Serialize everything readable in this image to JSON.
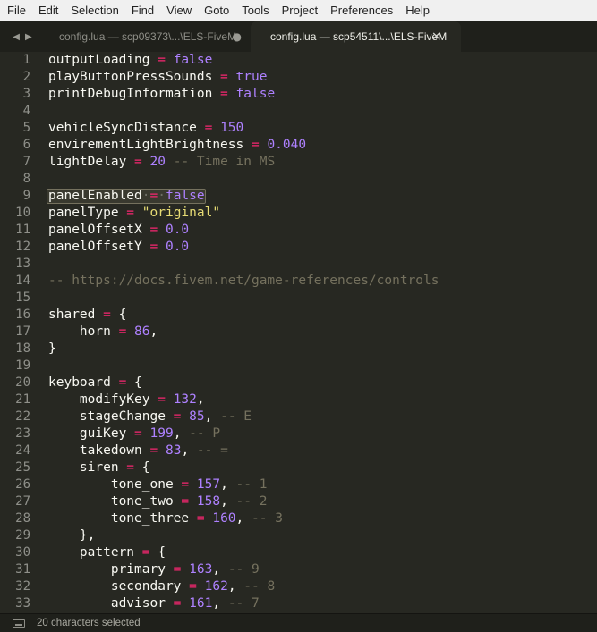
{
  "menu": [
    "File",
    "Edit",
    "Selection",
    "Find",
    "View",
    "Goto",
    "Tools",
    "Project",
    "Preferences",
    "Help"
  ],
  "tabs": [
    {
      "label": "config.lua — scp09373\\...\\ELS-FiveM",
      "indicator": "●",
      "active": false
    },
    {
      "label": "config.lua — scp54511\\...\\ELS-FiveM",
      "indicator": "✕",
      "active": true
    }
  ],
  "nav": {
    "back": "◀",
    "forward": "▶"
  },
  "editor": {
    "highlighted_line": 9,
    "lines": [
      {
        "n": "1",
        "tokens": [
          {
            "t": "outputLoading",
            "c": "plain"
          },
          {
            "t": " = ",
            "c": "op"
          },
          {
            "t": "false",
            "c": "const"
          }
        ]
      },
      {
        "n": "2",
        "tokens": [
          {
            "t": "playButtonPressSounds",
            "c": "plain"
          },
          {
            "t": " = ",
            "c": "op"
          },
          {
            "t": "true",
            "c": "const"
          }
        ]
      },
      {
        "n": "3",
        "tokens": [
          {
            "t": "printDebugInformation",
            "c": "plain"
          },
          {
            "t": " = ",
            "c": "op"
          },
          {
            "t": "false",
            "c": "const"
          }
        ]
      },
      {
        "n": "4",
        "tokens": []
      },
      {
        "n": "5",
        "tokens": [
          {
            "t": "vehicleSyncDistance",
            "c": "plain"
          },
          {
            "t": " = ",
            "c": "op"
          },
          {
            "t": "150",
            "c": "num"
          }
        ]
      },
      {
        "n": "6",
        "tokens": [
          {
            "t": "envirementLightBrightness",
            "c": "plain"
          },
          {
            "t": " = ",
            "c": "op"
          },
          {
            "t": "0.040",
            "c": "num"
          }
        ]
      },
      {
        "n": "7",
        "tokens": [
          {
            "t": "lightDelay",
            "c": "plain"
          },
          {
            "t": " = ",
            "c": "op"
          },
          {
            "t": "20",
            "c": "num"
          },
          {
            "t": " -- Time in MS",
            "c": "comment"
          }
        ]
      },
      {
        "n": "8",
        "tokens": []
      },
      {
        "n": "9",
        "tokens": [
          {
            "t": "panelEnabled",
            "c": "plain"
          },
          {
            "t": "·",
            "c": "ws"
          },
          {
            "t": "=",
            "c": "op"
          },
          {
            "t": "·",
            "c": "ws"
          },
          {
            "t": "false",
            "c": "const"
          }
        ]
      },
      {
        "n": "10",
        "tokens": [
          {
            "t": "panelType",
            "c": "plain"
          },
          {
            "t": " = ",
            "c": "op"
          },
          {
            "t": "\"original\"",
            "c": "str"
          }
        ]
      },
      {
        "n": "11",
        "tokens": [
          {
            "t": "panelOffsetX",
            "c": "plain"
          },
          {
            "t": " = ",
            "c": "op"
          },
          {
            "t": "0.0",
            "c": "num"
          }
        ]
      },
      {
        "n": "12",
        "tokens": [
          {
            "t": "panelOffsetY",
            "c": "plain"
          },
          {
            "t": " = ",
            "c": "op"
          },
          {
            "t": "0.0",
            "c": "num"
          }
        ]
      },
      {
        "n": "13",
        "tokens": []
      },
      {
        "n": "14",
        "tokens": [
          {
            "t": "-- https://docs.fivem.net/game-references/controls",
            "c": "comment"
          }
        ]
      },
      {
        "n": "15",
        "tokens": []
      },
      {
        "n": "16",
        "tokens": [
          {
            "t": "shared",
            "c": "plain"
          },
          {
            "t": " = ",
            "c": "op"
          },
          {
            "t": "{",
            "c": "plain"
          }
        ]
      },
      {
        "n": "17",
        "tokens": [
          {
            "t": "    horn",
            "c": "plain"
          },
          {
            "t": " = ",
            "c": "op"
          },
          {
            "t": "86",
            "c": "num"
          },
          {
            "t": ",",
            "c": "plain"
          }
        ]
      },
      {
        "n": "18",
        "tokens": [
          {
            "t": "}",
            "c": "plain"
          }
        ]
      },
      {
        "n": "19",
        "tokens": []
      },
      {
        "n": "20",
        "tokens": [
          {
            "t": "keyboard",
            "c": "plain"
          },
          {
            "t": " = ",
            "c": "op"
          },
          {
            "t": "{",
            "c": "plain"
          }
        ]
      },
      {
        "n": "21",
        "tokens": [
          {
            "t": "    modifyKey",
            "c": "plain"
          },
          {
            "t": " = ",
            "c": "op"
          },
          {
            "t": "132",
            "c": "num"
          },
          {
            "t": ",",
            "c": "plain"
          }
        ]
      },
      {
        "n": "22",
        "tokens": [
          {
            "t": "    stageChange",
            "c": "plain"
          },
          {
            "t": " = ",
            "c": "op"
          },
          {
            "t": "85",
            "c": "num"
          },
          {
            "t": ",",
            "c": "plain"
          },
          {
            "t": " -- E",
            "c": "comment"
          }
        ]
      },
      {
        "n": "23",
        "tokens": [
          {
            "t": "    guiKey",
            "c": "plain"
          },
          {
            "t": " = ",
            "c": "op"
          },
          {
            "t": "199",
            "c": "num"
          },
          {
            "t": ",",
            "c": "plain"
          },
          {
            "t": " -- P",
            "c": "comment"
          }
        ]
      },
      {
        "n": "24",
        "tokens": [
          {
            "t": "    takedown",
            "c": "plain"
          },
          {
            "t": " = ",
            "c": "op"
          },
          {
            "t": "83",
            "c": "num"
          },
          {
            "t": ",",
            "c": "plain"
          },
          {
            "t": " -- =",
            "c": "comment"
          }
        ]
      },
      {
        "n": "25",
        "tokens": [
          {
            "t": "    siren",
            "c": "plain"
          },
          {
            "t": " = ",
            "c": "op"
          },
          {
            "t": "{",
            "c": "plain"
          }
        ]
      },
      {
        "n": "26",
        "tokens": [
          {
            "t": "        tone_one",
            "c": "plain"
          },
          {
            "t": " = ",
            "c": "op"
          },
          {
            "t": "157",
            "c": "num"
          },
          {
            "t": ",",
            "c": "plain"
          },
          {
            "t": " -- 1",
            "c": "comment"
          }
        ]
      },
      {
        "n": "27",
        "tokens": [
          {
            "t": "        tone_two",
            "c": "plain"
          },
          {
            "t": " = ",
            "c": "op"
          },
          {
            "t": "158",
            "c": "num"
          },
          {
            "t": ",",
            "c": "plain"
          },
          {
            "t": " -- 2",
            "c": "comment"
          }
        ]
      },
      {
        "n": "28",
        "tokens": [
          {
            "t": "        tone_three",
            "c": "plain"
          },
          {
            "t": " = ",
            "c": "op"
          },
          {
            "t": "160",
            "c": "num"
          },
          {
            "t": ",",
            "c": "plain"
          },
          {
            "t": " -- 3",
            "c": "comment"
          }
        ]
      },
      {
        "n": "29",
        "tokens": [
          {
            "t": "    },",
            "c": "plain"
          }
        ]
      },
      {
        "n": "30",
        "tokens": [
          {
            "t": "    pattern",
            "c": "plain"
          },
          {
            "t": " = ",
            "c": "op"
          },
          {
            "t": "{",
            "c": "plain"
          }
        ]
      },
      {
        "n": "31",
        "tokens": [
          {
            "t": "        primary",
            "c": "plain"
          },
          {
            "t": " = ",
            "c": "op"
          },
          {
            "t": "163",
            "c": "num"
          },
          {
            "t": ",",
            "c": "plain"
          },
          {
            "t": " -- 9",
            "c": "comment"
          }
        ]
      },
      {
        "n": "32",
        "tokens": [
          {
            "t": "        secondary",
            "c": "plain"
          },
          {
            "t": " = ",
            "c": "op"
          },
          {
            "t": "162",
            "c": "num"
          },
          {
            "t": ",",
            "c": "plain"
          },
          {
            "t": " -- 8",
            "c": "comment"
          }
        ]
      },
      {
        "n": "33",
        "tokens": [
          {
            "t": "        advisor",
            "c": "plain"
          },
          {
            "t": " = ",
            "c": "op"
          },
          {
            "t": "161",
            "c": "num"
          },
          {
            "t": ",",
            "c": "plain"
          },
          {
            "t": " -- 7",
            "c": "comment"
          }
        ]
      }
    ]
  },
  "status": {
    "icon": "panel-icon",
    "text": "20 characters selected"
  },
  "colors": {
    "background": "#272822",
    "keyword": "#f92672",
    "number": "#ae81ff",
    "string": "#e6db74",
    "comment": "#75715e"
  }
}
